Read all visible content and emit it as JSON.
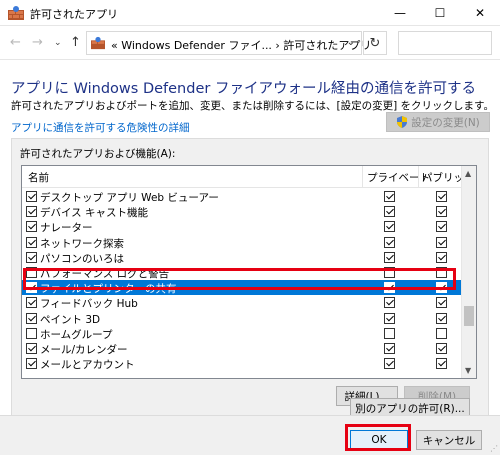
{
  "window": {
    "title": "許可されたアプリ",
    "minimize": "—",
    "maximize": "☐",
    "close": "✕"
  },
  "address": {
    "crumb": "« Windows Defender ファイ... › 許可されたアプリ",
    "back": "←",
    "forward": "→",
    "recent": "⌄",
    "up": "↑",
    "dropdown": "⌄",
    "refresh": "↻",
    "search_placeholder": ""
  },
  "content": {
    "heading": "アプリに Windows Defender ファイアウォール経由の通信を許可する",
    "subtext": "許可されたアプリおよびポートを追加、変更、または削除するには、[設定の変更] をクリックします。",
    "risk_link": "アプリに通信を許可する危険性の詳細",
    "change_settings": "設定の変更(N)"
  },
  "list": {
    "group_label": "許可されたアプリおよび機能(A):",
    "columns": {
      "name": "名前",
      "private": "プライベート",
      "public": "パブリック"
    },
    "rows": [
      {
        "name": "デスクトップ アプリ Web ビューアー",
        "enabled": true,
        "private": true,
        "public": true,
        "selected": false
      },
      {
        "name": "デバイス キャスト機能",
        "enabled": true,
        "private": true,
        "public": true,
        "selected": false
      },
      {
        "name": "ナレーター",
        "enabled": true,
        "private": true,
        "public": true,
        "selected": false
      },
      {
        "name": "ネットワーク探索",
        "enabled": true,
        "private": true,
        "public": true,
        "selected": false
      },
      {
        "name": "パソコンのいろは",
        "enabled": true,
        "private": true,
        "public": true,
        "selected": false
      },
      {
        "name": "パフォーマンス ログと警告",
        "enabled": false,
        "private": false,
        "public": false,
        "selected": false
      },
      {
        "name": "ファイルとプリンターの共有",
        "enabled": true,
        "private": true,
        "public": true,
        "selected": true
      },
      {
        "name": "フィードバック Hub",
        "enabled": true,
        "private": true,
        "public": true,
        "selected": false
      },
      {
        "name": "ペイント 3D",
        "enabled": true,
        "private": true,
        "public": true,
        "selected": false
      },
      {
        "name": "ホームグループ",
        "enabled": false,
        "private": false,
        "public": false,
        "selected": false
      },
      {
        "name": "メール/カレンダー",
        "enabled": true,
        "private": true,
        "public": true,
        "selected": false
      },
      {
        "name": "メールとアカウント",
        "enabled": true,
        "private": true,
        "public": true,
        "selected": false
      }
    ],
    "scroll_up": "▲",
    "scroll_down": "▼"
  },
  "actions": {
    "details": "詳細(L)...",
    "remove": "削除(M)",
    "allow_other": "別のアプリの許可(R)...",
    "ok": "OK",
    "cancel": "キャンセル"
  },
  "colors": {
    "heading": "#1e3287",
    "link": "#0066cc",
    "selection": "#0078d7",
    "highlight": "#e60012"
  }
}
